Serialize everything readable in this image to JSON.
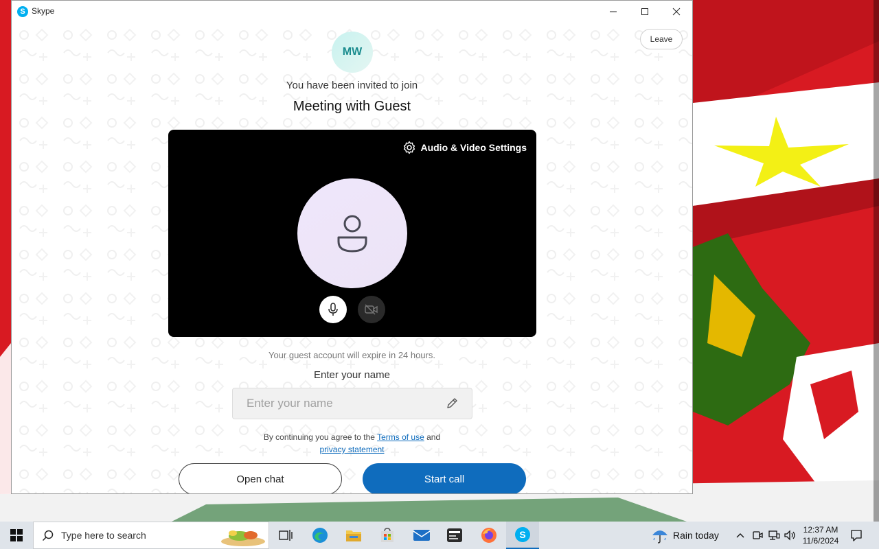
{
  "window": {
    "title": "Skype",
    "leave_label": "Leave"
  },
  "meeting": {
    "avatar_initials": "MW",
    "invite_text": "You have been invited to join",
    "title": "Meeting with Guest"
  },
  "video": {
    "settings_label": "Audio & Video Settings"
  },
  "join_form": {
    "expire_notice": "Your guest account will expire in 24 hours.",
    "name_label": "Enter your name",
    "name_placeholder": "Enter your name",
    "name_value": "",
    "terms_prefix": "By continuing you agree to the",
    "terms_link": "Terms of use",
    "terms_and": "and",
    "privacy_link": "privacy statement",
    "open_chat_label": "Open chat",
    "start_call_label": "Start call"
  },
  "taskbar": {
    "search_placeholder": "Type here to search",
    "weather_label": "Rain today",
    "time": "12:37 AM",
    "date": "11/6/2024",
    "pinned": [
      "task-view-icon",
      "edge-icon",
      "file-explorer-icon",
      "store-icon",
      "mail-icon",
      "app-icon",
      "firefox-icon",
      "skype-icon"
    ]
  },
  "colors": {
    "accent": "#0f6cbd",
    "skype_blue": "#00aff0",
    "avatar_text": "#1a8c8e"
  }
}
